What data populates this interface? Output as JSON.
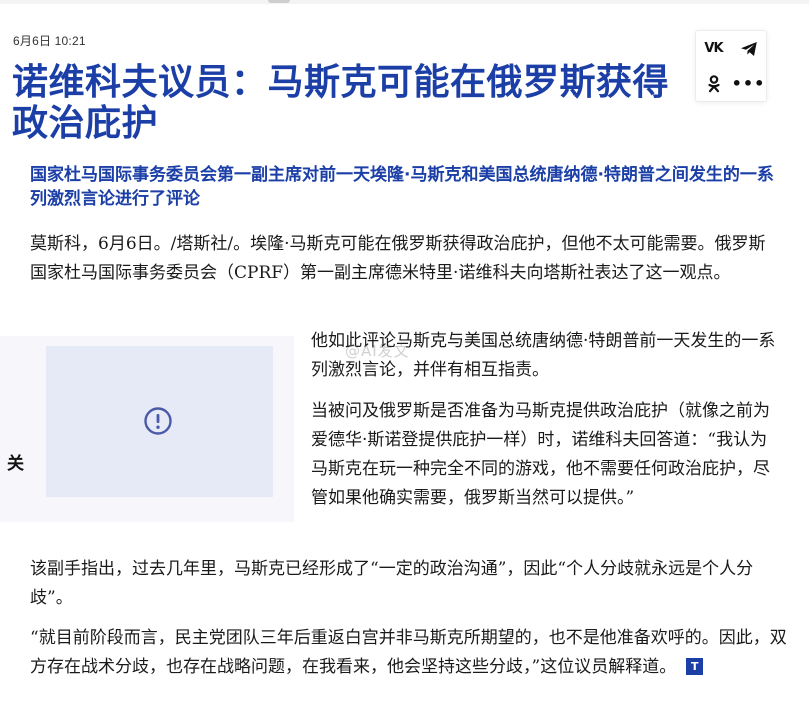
{
  "article": {
    "timestamp": "6月6日 10:21",
    "title": "诺维科夫议员：马斯克可能在俄罗斯获得政治庇护",
    "lead": "国家杜马国际事务委员会第一副主席对前一天埃隆·马斯克和美国总统唐纳德·特朗普之间发生的一系列激烈言论进行了评论",
    "paragraphs": [
      "莫斯科，6月6日。/塔斯社/。埃隆·马斯克可能在俄罗斯获得政治庇护，但他不太可能需要。俄罗斯国家杜马国际事务委员会（CPRF）第一副主席德米特里·诺维科夫向塔斯社表达了这一观点。",
      "他如此评论马斯克与美国总统唐纳德·特朗普前一天发生的一系列激烈言论，并伴有相互指责。",
      "当被问及俄罗斯是否准备为马斯克提供政治庇护（就像之前为爱德华·斯诺登提供庇护一样）时，诺维科夫回答道：“我认为马斯克在玩一种完全不同的游戏，他不需要任何政治庇护，尽管如果他确实需要，俄罗斯当然可以提供。”",
      "该副手指出，过去几年里，马斯克已经形成了“一定的政治沟通”，因此“个人分歧就永远是个人分歧”。",
      "“就目前阶段而言，民主党团队三年后重返白宫并非马斯克所期望的，也不是他准备欢呼的。因此，双方存在战术分歧，也存在战略问题，在我看来，他会坚持这些分歧，”这位议员解释道。"
    ],
    "end_badge": "T"
  },
  "share": {
    "vk_label": "VK",
    "vk_icon": "vk-icon",
    "telegram_icon": "telegram-icon",
    "ok_icon": "odnoklassniki-icon",
    "more_label": "•••",
    "more_icon": "more-icon"
  },
  "related": {
    "label": "关",
    "placeholder_icon": "exclamation-circle-icon"
  },
  "watermark": "@AI发文",
  "colors": {
    "accent": "#1b3fa6",
    "text": "#1a1a1a",
    "placeholder_bg": "#e6e9f6",
    "panel_bg": "#f7f7fb"
  }
}
